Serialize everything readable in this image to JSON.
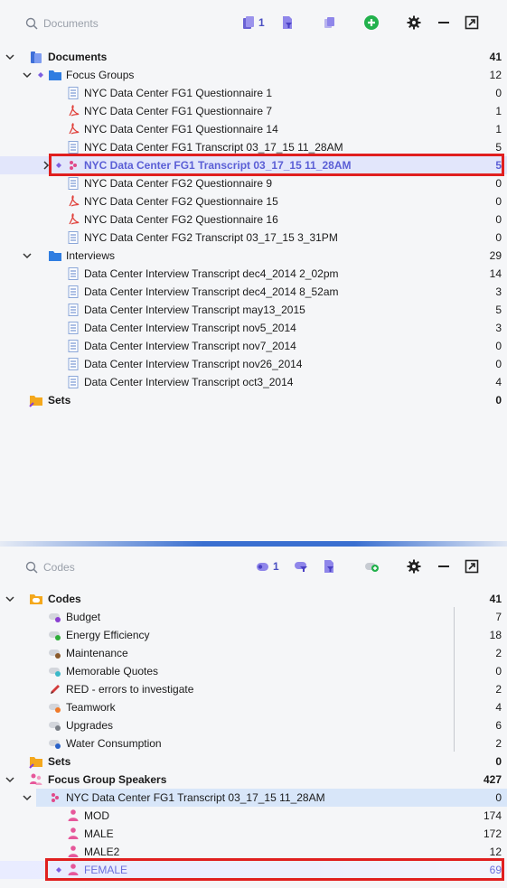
{
  "documents_panel": {
    "search_placeholder": "Documents",
    "toolbar": {
      "activated_count": "1"
    },
    "root": {
      "label": "Documents",
      "count": "41"
    },
    "groups": [
      {
        "label": "Focus Groups",
        "count": "12",
        "items": [
          {
            "label": "NYC Data Center FG1 Questionnaire 1",
            "count": "0",
            "type": "text"
          },
          {
            "label": "NYC Data Center FG1 Questionnaire 7",
            "count": "1",
            "type": "pdf"
          },
          {
            "label": "NYC Data Center FG1 Questionnaire 14",
            "count": "1",
            "type": "pdf"
          },
          {
            "label": "NYC Data Center FG1 Transcript 03_17_15 11_28AM",
            "count": "5",
            "type": "text"
          },
          {
            "label": "NYC Data Center FG1 Transcript 03_17_15 11_28AM",
            "count": "5",
            "type": "focus",
            "highlighted": true
          },
          {
            "label": "NYC Data Center FG2 Questionnaire 9",
            "count": "0",
            "type": "text"
          },
          {
            "label": "NYC Data Center FG2 Questionnaire 15",
            "count": "0",
            "type": "pdf"
          },
          {
            "label": "NYC Data Center FG2 Questionnaire 16",
            "count": "0",
            "type": "pdf"
          },
          {
            "label": "NYC Data Center FG2 Transcript 03_17_15 3_31PM",
            "count": "0",
            "type": "text"
          }
        ]
      },
      {
        "label": "Interviews",
        "count": "29",
        "items": [
          {
            "label": "Data Center Interview Transcript dec4_2014 2_02pm",
            "count": "14",
            "type": "text"
          },
          {
            "label": "Data Center Interview Transcript dec4_2014 8_52am",
            "count": "3",
            "type": "text"
          },
          {
            "label": "Data Center Interview Transcript may13_2015",
            "count": "5",
            "type": "text"
          },
          {
            "label": "Data Center Interview Transcript nov5_2014",
            "count": "3",
            "type": "text"
          },
          {
            "label": "Data Center Interview Transcript nov7_2014",
            "count": "0",
            "type": "text"
          },
          {
            "label": "Data Center Interview Transcript nov26_2014",
            "count": "0",
            "type": "text"
          },
          {
            "label": "Data Center Interview Transcript oct3_2014",
            "count": "4",
            "type": "text"
          }
        ]
      }
    ],
    "sets": {
      "label": "Sets",
      "count": "0"
    }
  },
  "codes_panel": {
    "search_placeholder": "Codes",
    "toolbar": {
      "activated_count": "1"
    },
    "root": {
      "label": "Codes",
      "count": "41"
    },
    "codes": [
      {
        "label": "Budget",
        "count": "7",
        "color": "#8a3fd1"
      },
      {
        "label": "Energy Efficiency",
        "count": "18",
        "color": "#2fae3a"
      },
      {
        "label": "Maintenance",
        "count": "2",
        "color": "#8a5a2b"
      },
      {
        "label": "Memorable Quotes",
        "count": "0",
        "color": "#3ab8c8"
      },
      {
        "label": "RED - errors to investigate",
        "count": "2",
        "color": "#d23b3b"
      },
      {
        "label": "Teamwork",
        "count": "4",
        "color": "#f07a2a"
      },
      {
        "label": "Upgrades",
        "count": "6",
        "color": "#7a7f86"
      },
      {
        "label": "Water Consumption",
        "count": "2",
        "color": "#2a62c8"
      }
    ],
    "sets": {
      "label": "Sets",
      "count": "0"
    },
    "speakers": {
      "label": "Focus Group Speakers",
      "count": "427"
    },
    "speaker_doc": {
      "label": "NYC Data Center FG1 Transcript 03_17_15 11_28AM",
      "count": "0"
    },
    "speaker_items": [
      {
        "label": "MOD",
        "count": "174"
      },
      {
        "label": "MALE",
        "count": "172"
      },
      {
        "label": "MALE2",
        "count": "12"
      },
      {
        "label": "FEMALE",
        "count": "69",
        "highlighted": true
      }
    ]
  },
  "colors": {
    "accent": "#5b5fd6",
    "selection_border": "#e01f1f",
    "folder": "#2f7de1",
    "add": "#22b14c"
  }
}
